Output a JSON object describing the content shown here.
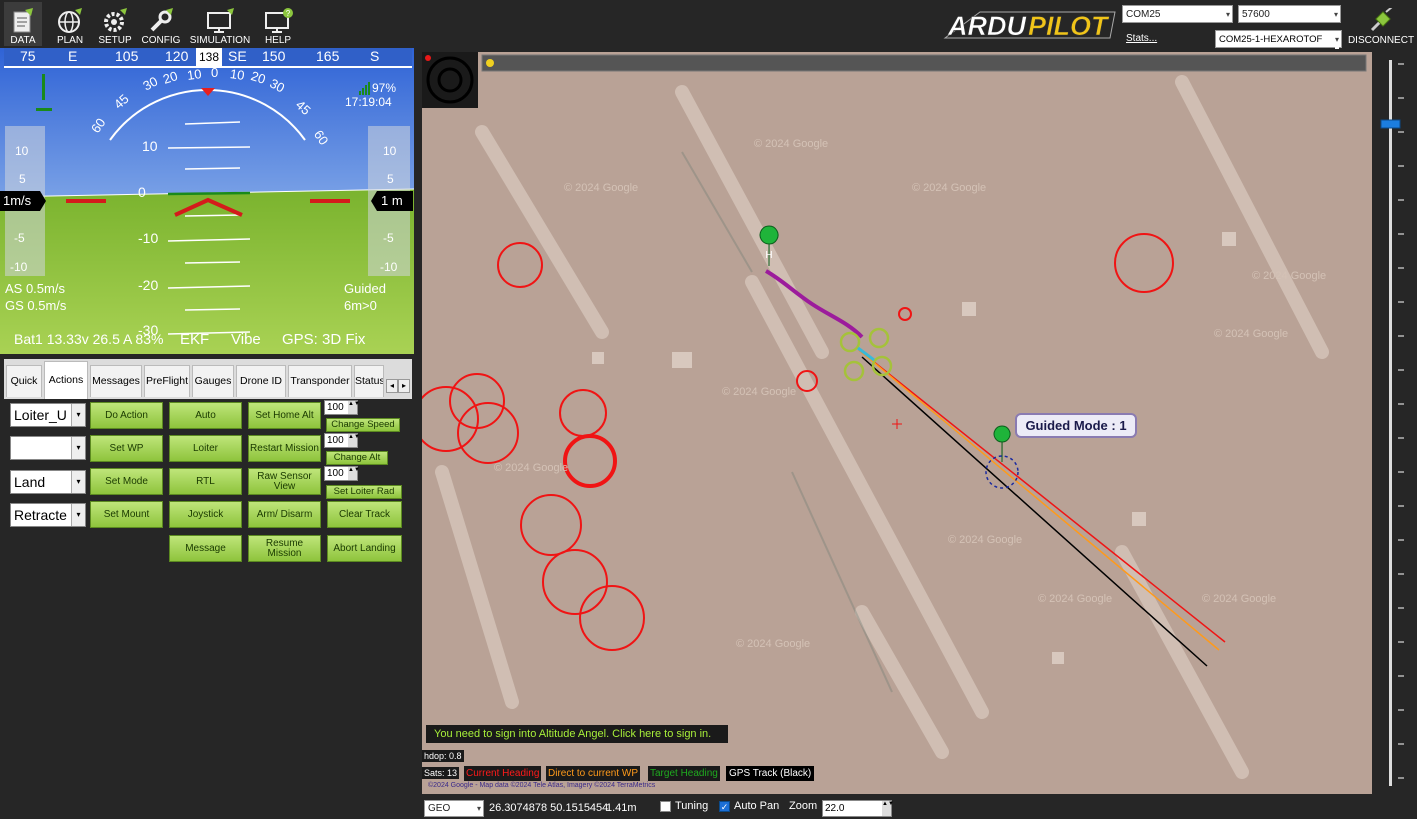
{
  "topbar": {
    "buttons": [
      {
        "label": "DATA",
        "icon": "data-icon"
      },
      {
        "label": "PLAN",
        "icon": "globe-icon"
      },
      {
        "label": "SETUP",
        "icon": "setup-gear-icon"
      },
      {
        "label": "CONFIG",
        "icon": "config-wrench-icon"
      },
      {
        "label": "SIMULATION",
        "icon": "simulation-monitor-icon"
      },
      {
        "label": "HELP",
        "icon": "help-monitor-icon"
      }
    ],
    "logo": "ARDUPILOT",
    "port": "COM25",
    "baud": "57600",
    "stats_label": "Stats...",
    "vehicle": "COM25-1-HEXAROTOF",
    "disconnect_label": "DISCONNECT"
  },
  "hud": {
    "heading_ticks": [
      "75",
      "E",
      "105",
      "120",
      "135",
      "SE",
      "150",
      "165",
      "S"
    ],
    "heading_value": "138",
    "roll_labels": [
      "60",
      "45",
      "30",
      "20",
      "10",
      "0",
      "10",
      "20",
      "30",
      "45",
      "60"
    ],
    "pitch_labels": [
      "10",
      "0",
      "-10",
      "-20",
      "-30"
    ],
    "speed_scale": [
      "10",
      "5",
      "0",
      "-5",
      "-10"
    ],
    "alt_scale": [
      "10",
      "5",
      "0",
      "-5",
      "-10"
    ],
    "speed_box": "1m/s",
    "alt_box": "1 m",
    "battery_pct": "97%",
    "time": "17:19:04",
    "airspeed": "AS 0.5m/s",
    "groundspeed": "GS 0.5m/s",
    "mode": "Guided",
    "wp_dist": "6m>0",
    "battery": "Bat1 13.33v 26.5 A 83%",
    "ekf": "EKF",
    "vibe": "Vibe",
    "gps": "GPS: 3D Fix"
  },
  "tabs": [
    "Quick",
    "Actions",
    "Messages",
    "PreFlight",
    "Gauges",
    "Drone ID",
    "Transponder",
    "Status"
  ],
  "actions": {
    "dropdowns": [
      "Loiter_U",
      "",
      "Land",
      "Retracte"
    ],
    "buttons": {
      "do_action": "Do Action",
      "auto": "Auto",
      "set_home_alt": "Set Home Alt",
      "set_wp": "Set WP",
      "loiter": "Loiter",
      "restart_mission": "Restart Mission",
      "set_mode": "Set Mode",
      "rtl": "RTL",
      "raw_sensor": "Raw Sensor View",
      "set_mount": "Set Mount",
      "joystick": "Joystick",
      "arm_disarm": "Arm/ Disarm",
      "clear_track": "Clear Track",
      "message": "Message",
      "resume_mission": "Resume Mission",
      "abort_landing": "Abort Landing"
    },
    "num_speed": "100",
    "change_speed": "Change Speed",
    "num_alt": "100",
    "change_alt": "Change Alt",
    "num_loiter": "100",
    "set_loiter_rad": "Set Loiter Rad"
  },
  "map": {
    "watermark": "© 2024 Google",
    "guided_label": "Guided Mode : 1",
    "altitude_angel": "You need to sign into Altitude Angel. Click here to sign in.",
    "hdop": "hdop: 0.8",
    "sats": "Sats: 13",
    "legend": [
      {
        "label": "Current Heading",
        "color": "#ff1a1a"
      },
      {
        "label": "Direct to current WP",
        "color": "#ff9a1a"
      },
      {
        "label": "Target Heading",
        "color": "#1faa1f"
      },
      {
        "label": "GPS Track (Black)",
        "color": "#ffffff"
      }
    ],
    "copyright": "©2024 Google - Map data ©2024 Tele Atlas, Imagery ©2024 TerraMetrics"
  },
  "statusbar": {
    "coord_type": "GEO",
    "coords": "26.3074878 50.1515454",
    "alt": "1.41m",
    "tuning_label": "Tuning",
    "tuning_checked": false,
    "autopan_label": "Auto Pan",
    "autopan_checked": true,
    "zoom_label": "Zoom",
    "zoom_value": "22.0"
  }
}
